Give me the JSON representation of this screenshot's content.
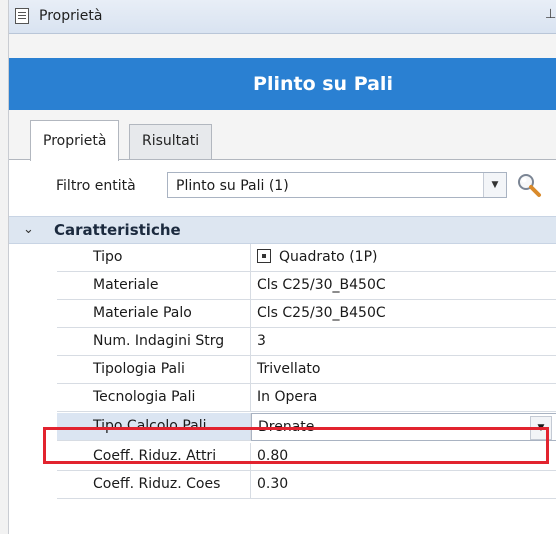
{
  "window": {
    "title": "Proprietà",
    "pin_glyph": "⊥"
  },
  "banner": {
    "title": "Plinto su Pali",
    "color": "#2a80d2"
  },
  "tabs": [
    {
      "label": "Proprietà",
      "active": true
    },
    {
      "label": "Risultati",
      "active": false
    }
  ],
  "filter": {
    "label": "Filtro entità",
    "value": "Plinto su Pali (1)"
  },
  "section": {
    "label": "Caratteristiche",
    "expanded": true
  },
  "properties": [
    {
      "name": "Tipo",
      "value": "Quadrato (1P)",
      "icon": "checkbox-icon"
    },
    {
      "name": "Materiale",
      "value": "Cls C25/30_B450C"
    },
    {
      "name": "Materiale Palo",
      "value": "Cls C25/30_B450C"
    },
    {
      "name": "Num. Indagini Strg",
      "value": "3"
    },
    {
      "name": "Tipologia Pali",
      "value": "Trivellato"
    },
    {
      "name": "Tecnologia Pali",
      "value": "In Opera"
    },
    {
      "name": "Tipo Calcolo Pali",
      "value": "Drenate",
      "selected": true
    },
    {
      "name": "Coeff. Riduz. Attri",
      "value": "0.80"
    },
    {
      "name": "Coeff. Riduz. Coes",
      "value": "0.30"
    }
  ],
  "highlight_color": "#e2232f"
}
